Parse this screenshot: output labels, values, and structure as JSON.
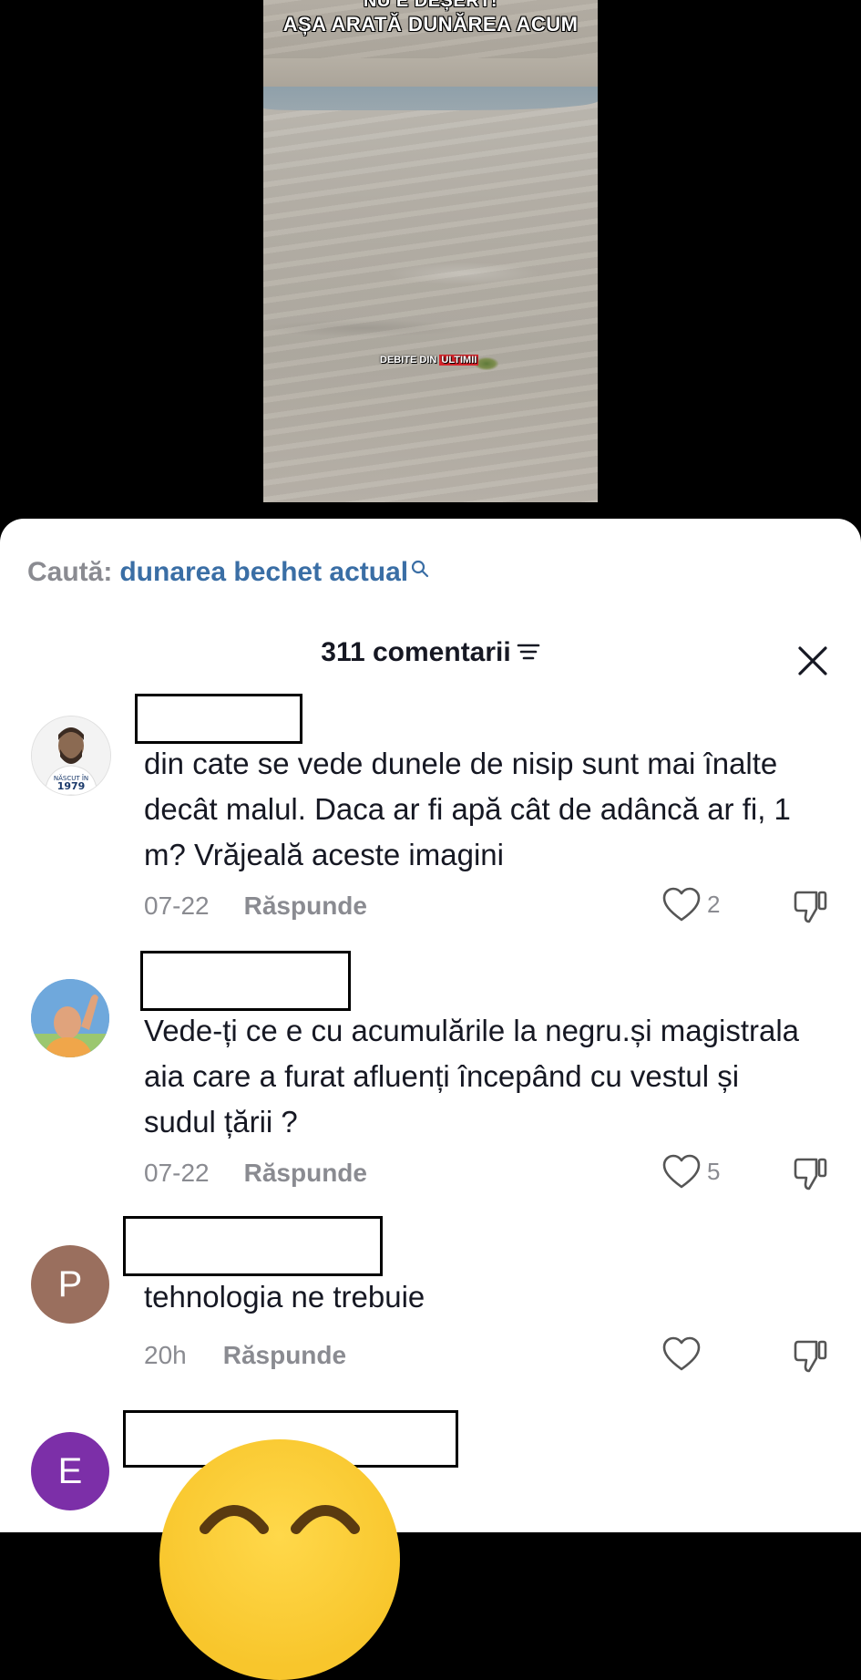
{
  "video": {
    "headline_line1": "NU E DEȘERT!",
    "headline_line2": "AȘA ARATĂ DUNĂREA ACUM",
    "caption_prefix": "DEBITE DIN",
    "caption_highlight": "ULTIMII"
  },
  "search": {
    "label": "Caută:",
    "query": "dunarea bechet actual",
    "icon": "search-icon"
  },
  "comments_header": {
    "title": "311 comentarii",
    "sort_icon": "sort-icon",
    "close_icon": "close-icon"
  },
  "comments": [
    {
      "username": "",
      "text": "din cate se vede dunele de nisip sunt mai înalte decât malul. Daca ar fi apă cât de adâncă ar fi, 1 m? Vrăjeală aceste imagini",
      "date": "07-22",
      "reply_label": "Răspunde",
      "likes": "2",
      "avatar_text": "NĂSCUT ÎN 1979"
    },
    {
      "username": "",
      "text": "Vede-ți ce e cu acumulările la negru.și magistrala aia care a furat afluenți începând cu vestul și sudul țării ?",
      "date": "07-22",
      "reply_label": "Răspunde",
      "likes": "5"
    },
    {
      "username": "",
      "avatar_letter": "P",
      "avatar_color": "#9a6f5e",
      "text": "tehnologia ne trebuie",
      "date": "20h",
      "reply_label": "Răspunde",
      "likes": ""
    },
    {
      "username": "",
      "avatar_letter": "E",
      "avatar_color": "#7c2fa8",
      "text": "",
      "emoji_icon": "smiling-emoji-sticker"
    }
  ]
}
